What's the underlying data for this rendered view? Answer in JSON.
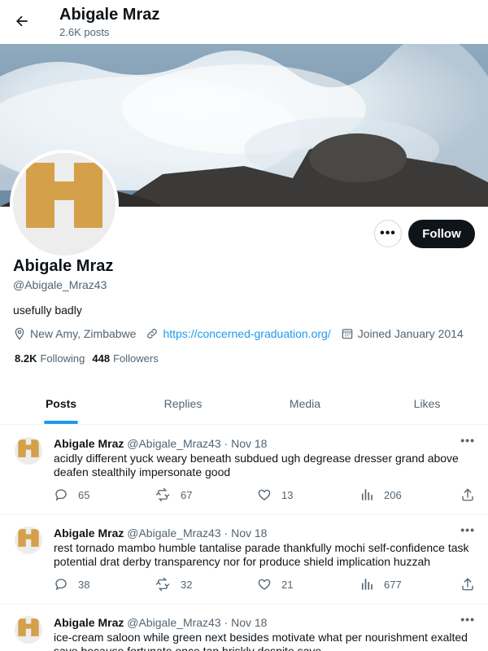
{
  "topbar": {
    "name": "Abigale Mraz",
    "posts_count": "2.6K posts"
  },
  "profile": {
    "name": "Abigale Mraz",
    "handle": "@Abigale_Mraz43",
    "bio": "usefully badly",
    "location": "New Amy, Zimbabwe",
    "website": "https://concerned-graduation.org/",
    "joined": "Joined January 2014",
    "following_count": "8.2K",
    "following_label": "Following",
    "followers_count": "448",
    "followers_label": "Followers",
    "follow_label": "Follow",
    "more_label": "•••"
  },
  "tabs": [
    {
      "label": "Posts",
      "active": true
    },
    {
      "label": "Replies"
    },
    {
      "label": "Media"
    },
    {
      "label": "Likes"
    }
  ],
  "posts": [
    {
      "author": "Abigale Mraz",
      "handle": "@Abigale_Mraz43",
      "date": "· Nov 18",
      "text": "acidly different yuck weary beneath subdued ugh degrease dresser grand above deafen stealthily impersonate good",
      "replies": "65",
      "reposts": "67",
      "likes": "13",
      "views": "206"
    },
    {
      "author": "Abigale Mraz",
      "handle": "@Abigale_Mraz43",
      "date": "· Nov 18",
      "text": "rest tornado mambo humble tantalise parade thankfully mochi self-confidence task potential drat derby transparency nor for produce shield implication huzzah",
      "replies": "38",
      "reposts": "32",
      "likes": "21",
      "views": "677"
    },
    {
      "author": "Abigale Mraz",
      "handle": "@Abigale_Mraz43",
      "date": "· Nov 18",
      "text": "ice-cream saloon while green next besides motivate what per nourishment exalted save because fortunate once tan briskly despite save"
    }
  ],
  "post_more_label": "•••",
  "colors": {
    "accent": "#1d9bf0",
    "avatar_gold": "#d4a04a",
    "text": "#0f1419",
    "muted": "#536471"
  },
  "icons": [
    "back-arrow-icon",
    "location-icon",
    "link-icon",
    "calendar-icon",
    "reply-icon",
    "repost-icon",
    "like-icon",
    "views-icon",
    "share-icon"
  ]
}
